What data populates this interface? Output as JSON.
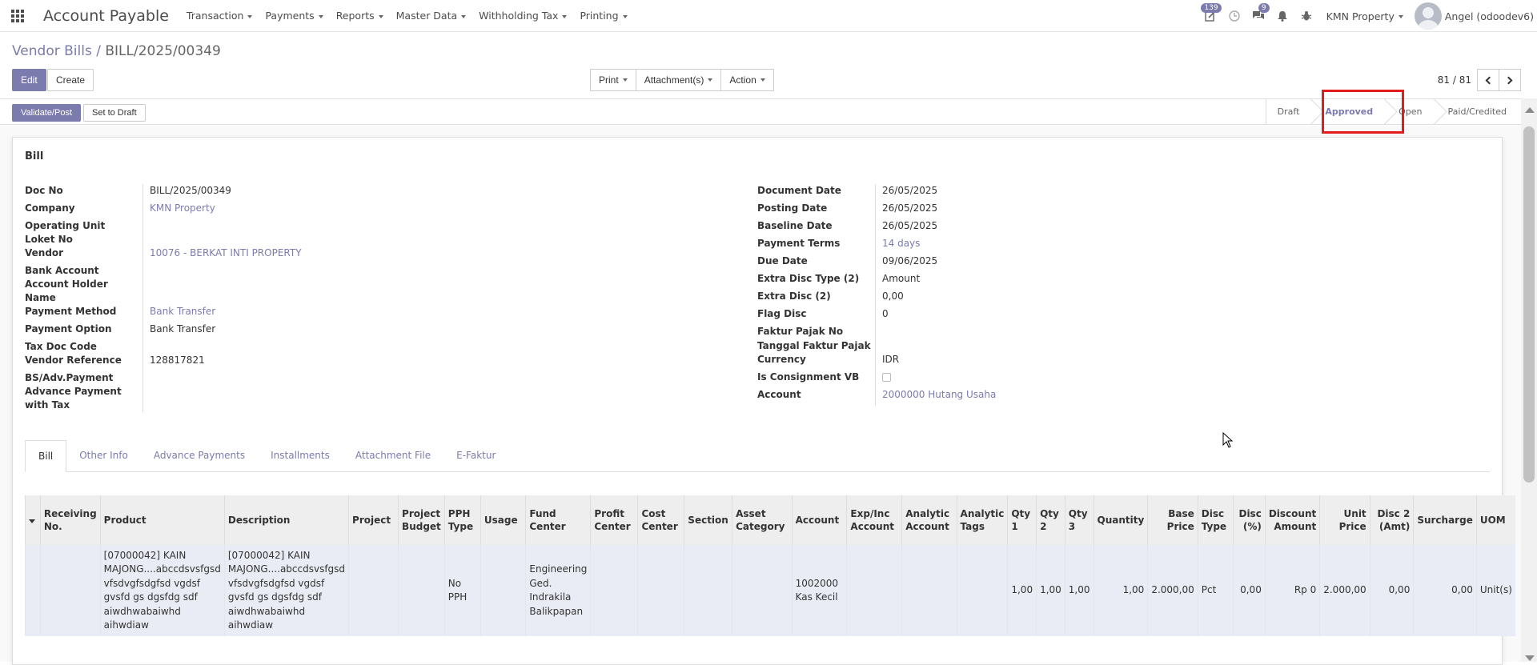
{
  "navbar": {
    "app_title": "Account Payable",
    "menu": [
      "Transaction",
      "Payments",
      "Reports",
      "Master Data",
      "Withholding Tax",
      "Printing"
    ],
    "activity_badge": "139",
    "chat_badge": "9",
    "company": "KMN Property",
    "user": "Angel (odoodev6)"
  },
  "breadcrumb": {
    "parent": "Vendor Bills",
    "separator": "/",
    "current": "BILL/2025/00349"
  },
  "controls": {
    "edit": "Edit",
    "create": "Create",
    "print": "Print",
    "attachments": "Attachment(s)",
    "action": "Action",
    "pager": "81 / 81"
  },
  "statusbar": {
    "validate": "Validate/Post",
    "set_to_draft": "Set to Draft",
    "stages": [
      "Draft",
      "Approved",
      "Open",
      "Paid/Credited"
    ],
    "current_stage": "Approved"
  },
  "sheet_title": "Bill",
  "left_fields": [
    {
      "label": "Doc No",
      "value": "BILL/2025/00349",
      "link": false
    },
    {
      "label": "Company",
      "value": "KMN Property",
      "link": true
    },
    {
      "label": "Operating Unit",
      "value": "",
      "link": false
    },
    {
      "label": "Loket No",
      "value": "",
      "link": false
    },
    {
      "label": "Vendor",
      "value": "10076 - BERKAT INTI PROPERTY",
      "link": true
    },
    {
      "label": "Bank Account",
      "value": "",
      "link": false
    },
    {
      "label": "Account Holder Name",
      "value": "",
      "link": false
    },
    {
      "label": "Payment Method",
      "value": "Bank Transfer",
      "link": true
    },
    {
      "label": "Payment Option",
      "value": "Bank Transfer",
      "link": false
    },
    {
      "label": "Tax Doc Code",
      "value": "",
      "link": false
    },
    {
      "label": "Vendor Reference",
      "value": "128817821",
      "link": false
    },
    {
      "label": "BS/Adv.Payment",
      "value": "",
      "link": false
    },
    {
      "label": "Advance Payment with Tax",
      "value": "",
      "link": false
    }
  ],
  "right_fields": [
    {
      "label": "Document Date",
      "value": "26/05/2025",
      "link": false
    },
    {
      "label": "Posting Date",
      "value": "26/05/2025",
      "link": false
    },
    {
      "label": "Baseline Date",
      "value": "26/05/2025",
      "link": false
    },
    {
      "label": "Payment Terms",
      "value": "14 days",
      "link": true
    },
    {
      "label": "Due Date",
      "value": "09/06/2025",
      "link": false
    },
    {
      "label": "Extra Disc Type (2)",
      "value": "Amount",
      "link": false
    },
    {
      "label": "Extra Disc (2)",
      "value": "0,00",
      "link": false
    },
    {
      "label": "Flag Disc",
      "value": "0",
      "link": false
    },
    {
      "label": "Faktur Pajak No",
      "value": "",
      "link": false
    },
    {
      "label": "Tanggal Faktur Pajak",
      "value": "",
      "link": false
    },
    {
      "label": "Currency",
      "value": "IDR",
      "link": false
    },
    {
      "label": "Is Consignment VB",
      "value": "",
      "link": false
    },
    {
      "label": "Account",
      "value": "2000000 Hutang Usaha",
      "link": true
    }
  ],
  "tabs": [
    "Bill",
    "Other Info",
    "Advance Payments",
    "Installments",
    "Attachment File",
    "E-Faktur"
  ],
  "table": {
    "headers": [
      "Receiving No.",
      "Product",
      "Description",
      "Project",
      "Project Budget",
      "PPH Type",
      "Usage",
      "Fund Center",
      "Profit Center",
      "Cost Center",
      "Section",
      "Asset Category",
      "Account",
      "Exp/Inc Account",
      "Analytic Account",
      "Analytic Tags",
      "Qty 1",
      "Qty 2",
      "Qty 3",
      "Quantity",
      "Base Price",
      "Disc Type",
      "Disc (%)",
      "Discount Amount",
      "Unit Price",
      "Disc 2 (Amt)",
      "Surcharge",
      "UOM"
    ],
    "row": [
      "",
      "[07000042] KAIN MAJONG....abccdsvsfgsd vfsdvgfsdgfsd vgdsf gvsfd gs dgsfdg sdf aiwdhwabaiwhd aihwdiaw",
      "[07000042] KAIN MAJONG....abccdsvsfgsd vfsdvgfsdgfsd vgdsf gvsfd gs dgsfdg sdf aiwdhwabaiwhd aihwdiaw",
      "",
      "",
      "No PPH",
      "",
      "Engineering Ged. Indrakila Balikpapan",
      "",
      "",
      "",
      "",
      "1002000 Kas Kecil",
      "",
      "",
      "",
      "1,00",
      "1,00",
      "1,00",
      "1,00",
      "2.000,00",
      "Pct",
      "0,00",
      "Rp 0",
      "2.000,00",
      "0,00",
      "0,00",
      "Unit(s)"
    ]
  }
}
